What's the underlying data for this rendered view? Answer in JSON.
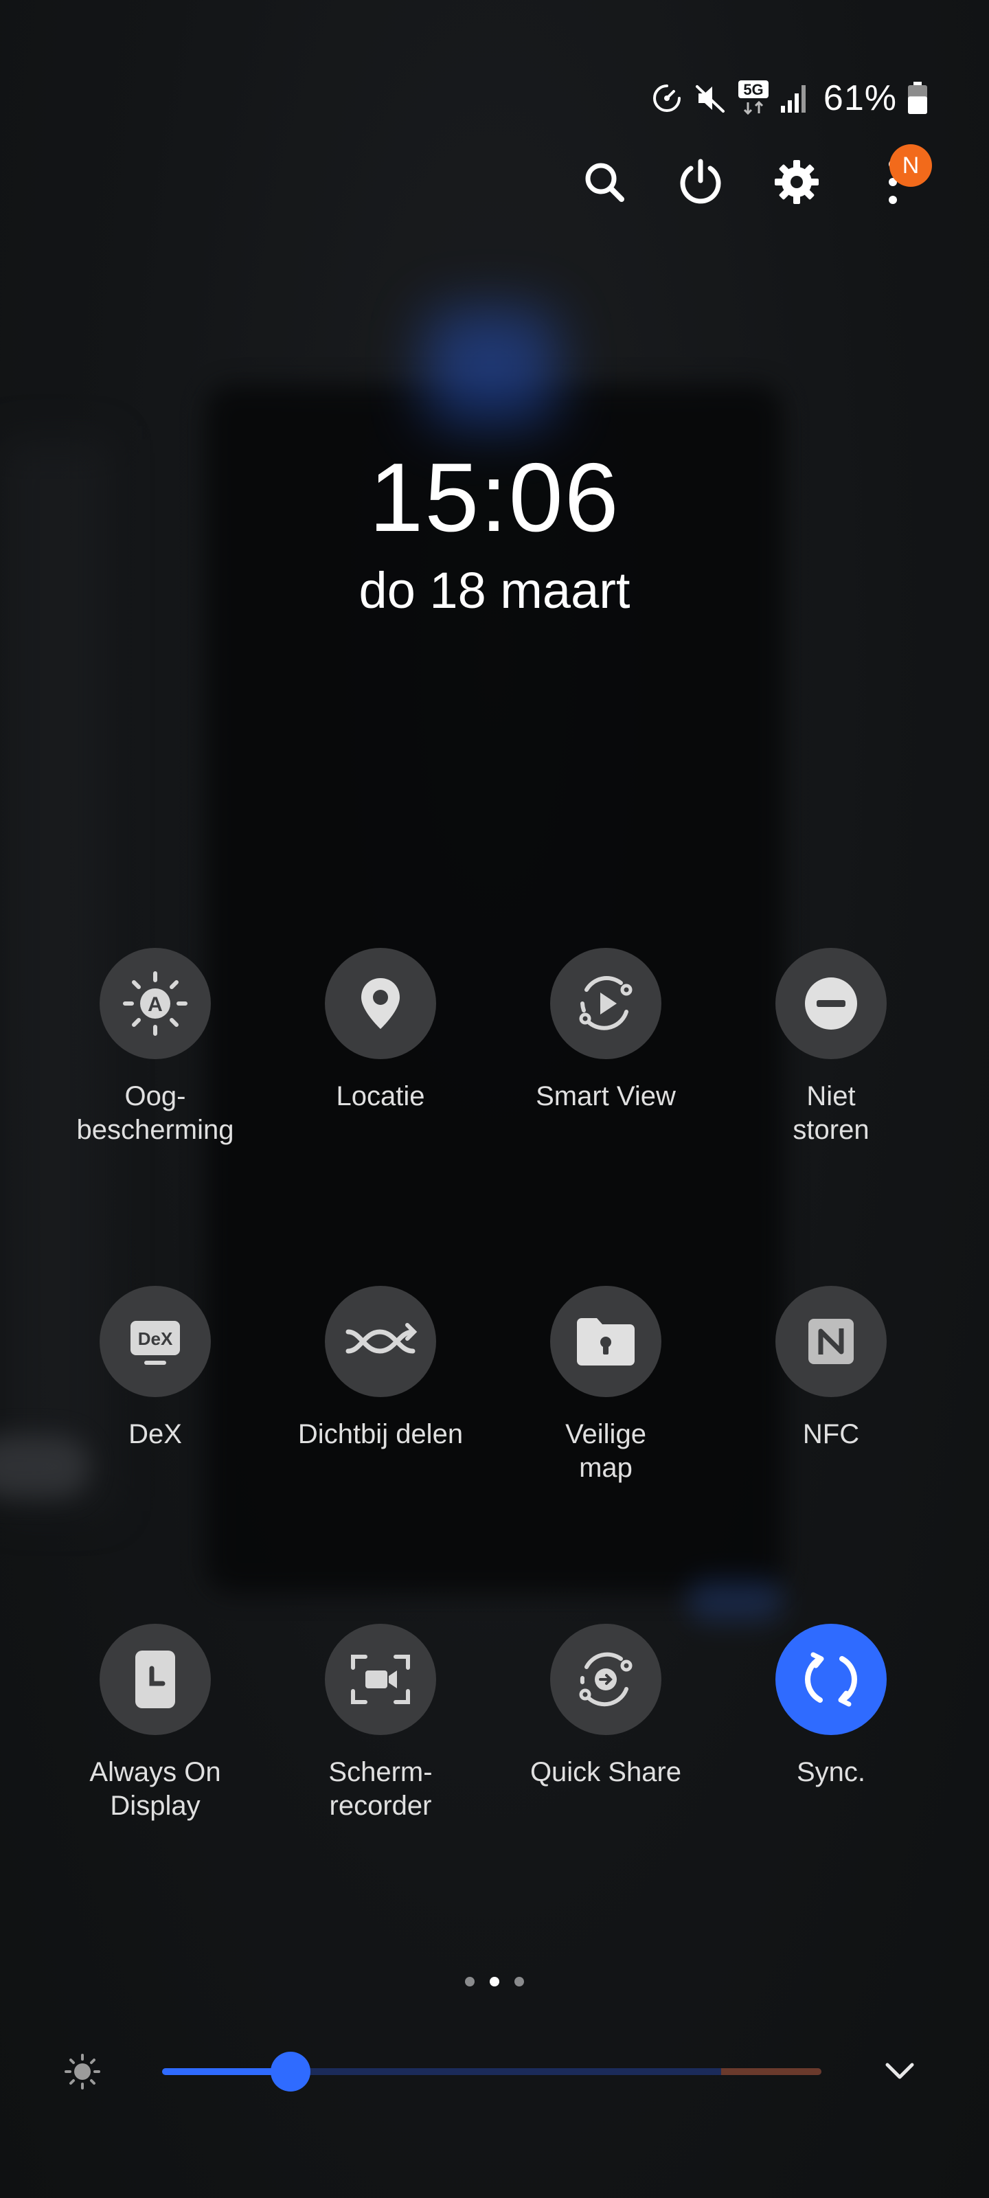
{
  "status": {
    "battery_percent": "61%",
    "battery_level": 0.61,
    "network": "5G",
    "icons": [
      "data-saver-icon",
      "mute-icon",
      "5g-icon",
      "signal-icon",
      "battery-icon"
    ]
  },
  "header": {
    "actions": [
      "search-icon",
      "power-icon",
      "gear-icon",
      "more-icon"
    ],
    "notification_badge": "N"
  },
  "clock": {
    "time": "15:06",
    "date": "do 18 maart"
  },
  "tiles": [
    {
      "label": "Oog-\nbescherming",
      "icon": "eye-comfort-icon",
      "active": false
    },
    {
      "label": "Locatie",
      "icon": "location-icon",
      "active": false
    },
    {
      "label": "Smart View",
      "icon": "smart-view-icon",
      "active": false
    },
    {
      "label": "Niet\nstoren",
      "icon": "do-not-disturb-icon",
      "active": false
    },
    {
      "label": "DeX",
      "icon": "dex-icon",
      "active": false
    },
    {
      "label": "Dichtbij delen",
      "icon": "nearby-share-icon",
      "active": false
    },
    {
      "label": "Veilige\nmap",
      "icon": "secure-folder-icon",
      "active": false
    },
    {
      "label": "NFC",
      "icon": "nfc-icon",
      "active": false
    },
    {
      "label": "Always On\nDisplay",
      "icon": "always-on-display-icon",
      "active": false
    },
    {
      "label": "Scherm-\nrecorder",
      "icon": "screen-recorder-icon",
      "active": false
    },
    {
      "label": "Quick Share",
      "icon": "quick-share-icon",
      "active": false
    },
    {
      "label": "Sync.",
      "icon": "sync-icon",
      "active": true
    }
  ],
  "pager": {
    "pages": 3,
    "current": 1
  },
  "brightness": {
    "level": 0.195,
    "colors": {
      "fill": "#2f6bff",
      "warm": "#6a3a2c"
    }
  },
  "colors": {
    "accent": "#2f6bff",
    "badge": "#f26a1b",
    "tile": "#3b3c3e"
  }
}
